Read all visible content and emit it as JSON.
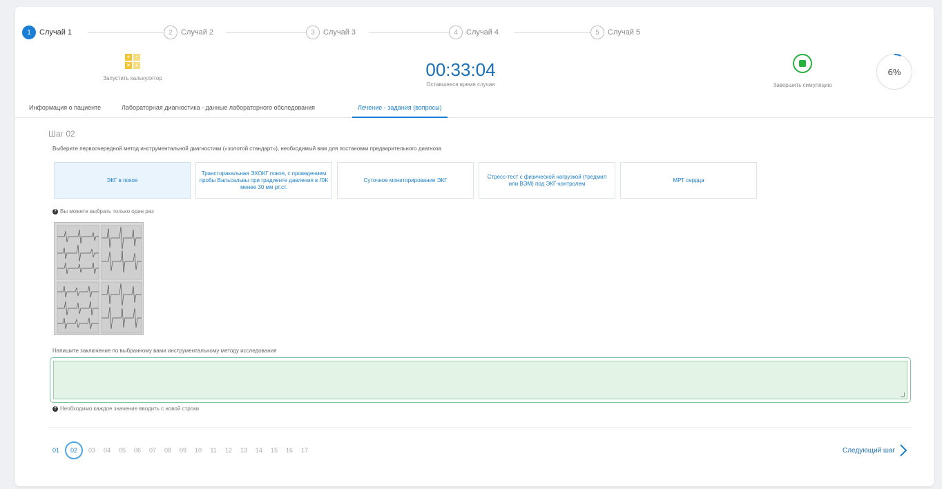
{
  "stepper": [
    {
      "num": "1",
      "label": "Случай 1",
      "active": true
    },
    {
      "num": "2",
      "label": "Случай 2",
      "active": false
    },
    {
      "num": "3",
      "label": "Случай 3",
      "active": false
    },
    {
      "num": "4",
      "label": "Случай 4",
      "active": false
    },
    {
      "num": "5",
      "label": "Случай 5",
      "active": false
    }
  ],
  "header": {
    "calculator_label": "Запустить калькулятор",
    "calculator_glyphs": [
      "+",
      "−",
      "×",
      "÷"
    ],
    "timer": "00:33:04",
    "timer_caption": "Оставшееся время случая",
    "finish_label": "Завершить симуляцию",
    "progress_percent": 6,
    "progress_text": "6%"
  },
  "tabs": [
    {
      "label": "Информация о пациенте",
      "active": false
    },
    {
      "label": "Лабораторная диагностика - данные лабораторного обследования",
      "active": false
    },
    {
      "label": "Лечение - задания (вопросы)",
      "active": true
    }
  ],
  "step": {
    "title": "Шаг 02",
    "question": "Выберите первоочередной метод инструментальной диагностики («золотой стандарт»), необходимый вам для постановки предварительного диагноза",
    "options": [
      {
        "label": "ЭКГ в покое",
        "selected": true
      },
      {
        "label": "Трансторакальная ЭХОКГ покоя, с проведением пробы Вальсальвы при градиенте давления в ЛЖ менее 30 мм рт.ст.",
        "selected": false
      },
      {
        "label": "Суточное мониторирование ЭКГ",
        "selected": false
      },
      {
        "label": "Стресс-тест с физической нагрузкой (тредмил или ВЭМ) под ЭКГ-контролем",
        "selected": false
      },
      {
        "label": "МРТ сердца",
        "selected": false
      }
    ],
    "single_choice_hint": "Вы можете выбрать только один раз",
    "conclusion_label": "Напишите заключение по выбранному вами инструментальному методу исследования",
    "answer_value": "",
    "newline_hint": "Необходимо каждое значение вводить с новой строки"
  },
  "pagination": {
    "pages": [
      "01",
      "02",
      "03",
      "04",
      "05",
      "06",
      "07",
      "08",
      "09",
      "10",
      "11",
      "12",
      "13",
      "14",
      "15",
      "16",
      "17"
    ],
    "current": "02",
    "next_label": "Следующий шаг"
  },
  "colors": {
    "accent": "#1a7fd4",
    "success": "#25b33d",
    "calculator": "#f5c531",
    "answer_bg": "#e3f4e7"
  }
}
